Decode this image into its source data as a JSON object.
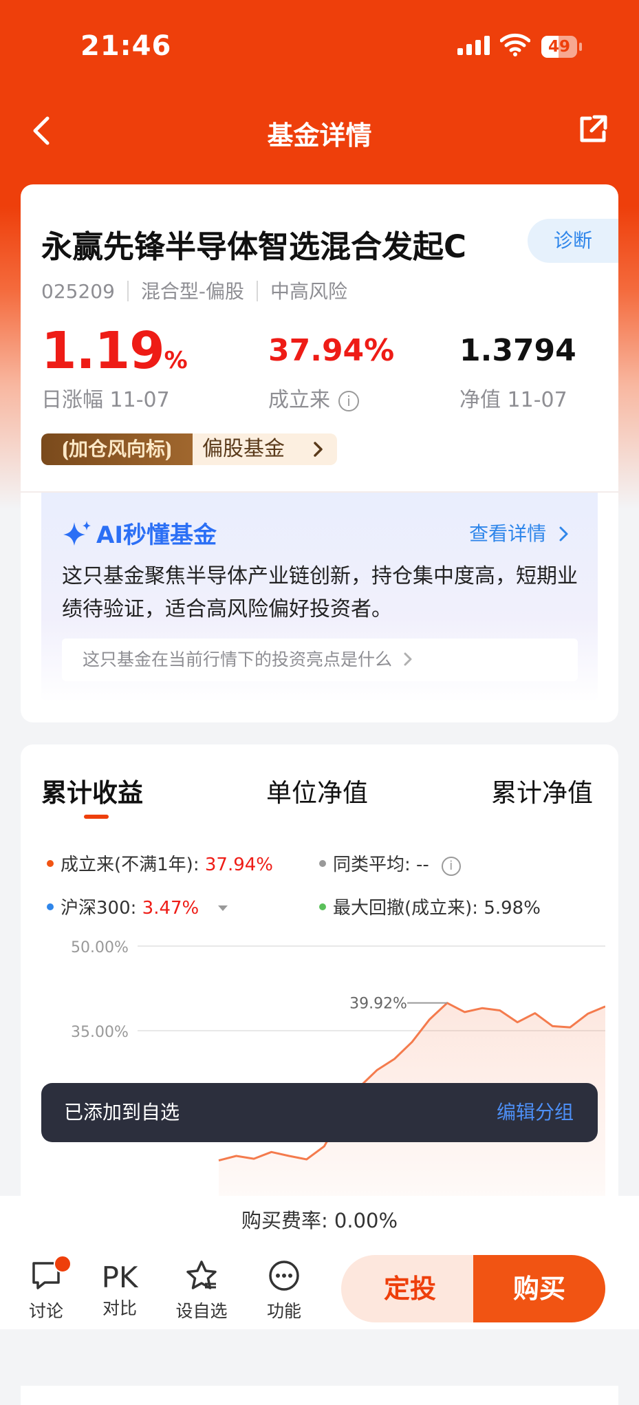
{
  "status_bar": {
    "time": "21:46",
    "battery": "49",
    "battery_level": 0.49
  },
  "nav": {
    "title": "基金详情"
  },
  "fund": {
    "name": "永赢先锋半导体智选混合发起C",
    "diagnose_label": "诊断",
    "code": "025209",
    "type": "混合型-偏股",
    "risk": "中高风险",
    "daily_change_value": "1.19",
    "daily_change_unit": "%",
    "daily_change_label": "日涨幅 11-07",
    "since_inception_value": "37.94%",
    "since_inception_label": "成立来",
    "nav_value": "1.3794",
    "nav_label": "净值 11-07",
    "tag_badge": "加仓风向标",
    "tag_text": "偏股基金"
  },
  "ai": {
    "title": "AI秒懂基金",
    "more": "查看详情",
    "summary": "这只基金聚焦半导体产业链创新，持仓集中度高，短期业绩待验证，适合高风险偏好投资者。",
    "question": "这只基金在当前行情下的投资亮点是什么"
  },
  "tabs": [
    "累计收益",
    "单位净值",
    "累计净值"
  ],
  "legend": {
    "since_label": "成立来(不满1年): ",
    "since_value": "37.94%",
    "peer_label": "同类平均: ",
    "peer_value": "--",
    "hs300_label": "沪深300: ",
    "hs300_value": "3.47%",
    "drawdown_label": "最大回撤(成立来): ",
    "drawdown_value": "5.98%"
  },
  "chart_data": {
    "type": "area",
    "y_ticks": [
      "50.00%",
      "35.00%"
    ],
    "peak_label": "39.92%",
    "ylim": [
      10,
      50
    ],
    "series": [
      {
        "name": "成立来",
        "color": "#f47b4d",
        "values": [
          12,
          12.8,
          12.3,
          13.5,
          12.8,
          12.2,
          14.5,
          20,
          25,
          28,
          30,
          33,
          37,
          39.92,
          38.3,
          39,
          38.6,
          36.5,
          38.1,
          35.8,
          35.6,
          38,
          39.3
        ]
      }
    ]
  },
  "toast": {
    "message": "已添加到自选",
    "action": "编辑分组"
  },
  "fee": {
    "text": "购买费率: 0.00%"
  },
  "bottom_bar": {
    "discuss": "讨论",
    "compare_icon": "PK",
    "compare": "对比",
    "watchlist": "设自选",
    "functions": "功能",
    "sip": "定投",
    "buy": "购买"
  },
  "colors": {
    "brand": "#ee3f0b",
    "up_red": "#ee1c16",
    "link_blue": "#2f86ea",
    "toast_bg": "#2c2f3d"
  }
}
